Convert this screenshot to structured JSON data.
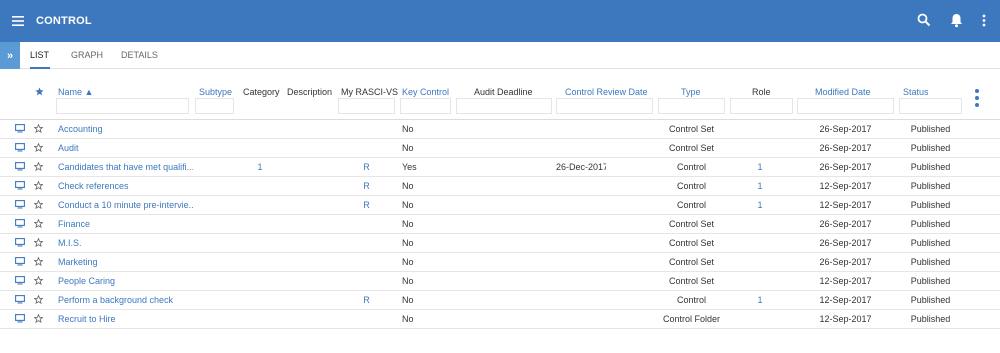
{
  "app": {
    "title": "CONTROL",
    "icons": [
      "menu-icon",
      "search-icon",
      "bell-icon",
      "more-vert-icon"
    ]
  },
  "tabs": [
    {
      "label": "LIST",
      "active": true
    },
    {
      "label": "GRAPH",
      "active": false
    },
    {
      "label": "DETAILS",
      "active": false
    }
  ],
  "columns": {
    "name": "Name ▲",
    "subtype": "Subtype",
    "category": "Category",
    "description": "Description",
    "rasci": "My RASCI-VS",
    "key_control": "Key Control",
    "audit_deadline": "Audit Deadline",
    "review_date": "Control Review Date",
    "type": "Type",
    "role": "Role",
    "modified": "Modified Date",
    "status": "Status"
  },
  "rows": [
    {
      "name": "Accounting",
      "category": "",
      "rasci": "",
      "key": "No",
      "review": "",
      "type": "Control Set",
      "role": "",
      "modified": "26-Sep-2017",
      "status": "Published"
    },
    {
      "name": "Audit",
      "category": "",
      "rasci": "",
      "key": "No",
      "review": "",
      "type": "Control Set",
      "role": "",
      "modified": "26-Sep-2017",
      "status": "Published"
    },
    {
      "name": "Candidates that have met qualifi...",
      "category": "1",
      "rasci": "R",
      "key": "Yes",
      "review": "26-Dec-2017",
      "type": "Control",
      "role": "1",
      "modified": "26-Sep-2017",
      "status": "Published"
    },
    {
      "name": "Check references",
      "category": "",
      "rasci": "R",
      "key": "No",
      "review": "",
      "type": "Control",
      "role": "1",
      "modified": "12-Sep-2017",
      "status": "Published"
    },
    {
      "name": "Conduct a 10 minute pre-intervie...",
      "category": "",
      "rasci": "R",
      "key": "No",
      "review": "",
      "type": "Control",
      "role": "1",
      "modified": "12-Sep-2017",
      "status": "Published"
    },
    {
      "name": "Finance",
      "category": "",
      "rasci": "",
      "key": "No",
      "review": "",
      "type": "Control Set",
      "role": "",
      "modified": "26-Sep-2017",
      "status": "Published"
    },
    {
      "name": "M.I.S.",
      "category": "",
      "rasci": "",
      "key": "No",
      "review": "",
      "type": "Control Set",
      "role": "",
      "modified": "26-Sep-2017",
      "status": "Published"
    },
    {
      "name": "Marketing",
      "category": "",
      "rasci": "",
      "key": "No",
      "review": "",
      "type": "Control Set",
      "role": "",
      "modified": "26-Sep-2017",
      "status": "Published"
    },
    {
      "name": "People Caring",
      "category": "",
      "rasci": "",
      "key": "No",
      "review": "",
      "type": "Control Set",
      "role": "",
      "modified": "12-Sep-2017",
      "status": "Published"
    },
    {
      "name": "Perform a background check",
      "category": "",
      "rasci": "R",
      "key": "No",
      "review": "",
      "type": "Control",
      "role": "1",
      "modified": "12-Sep-2017",
      "status": "Published"
    },
    {
      "name": "Recruit to Hire",
      "category": "",
      "rasci": "",
      "key": "No",
      "review": "",
      "type": "Control Folder",
      "role": "",
      "modified": "12-Sep-2017",
      "status": "Published"
    }
  ],
  "colors": {
    "brand": "#3d78be",
    "expander": "#5b9bd5",
    "link": "#3d78be"
  }
}
